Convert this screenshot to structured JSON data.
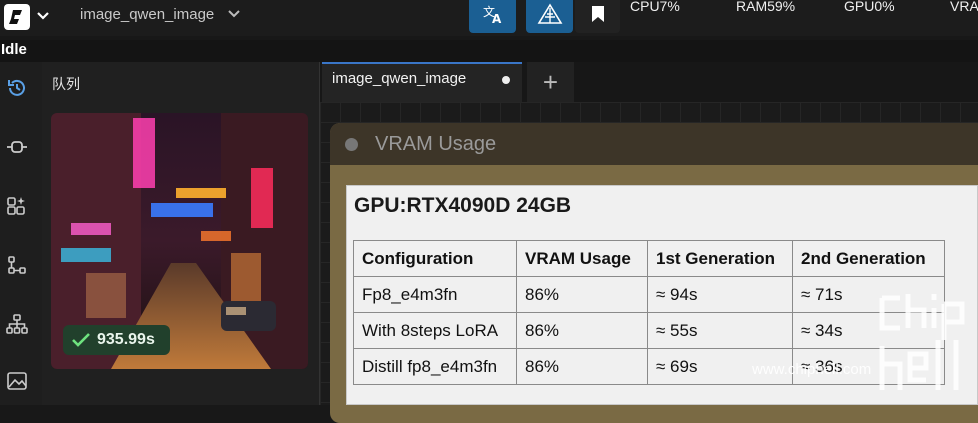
{
  "header": {
    "workflow_name": "image_qwen_image",
    "icons": {
      "logo": "comfy-logo-icon",
      "menu_chevron": "chevron-down-icon",
      "translate": "translate-icon",
      "manager": "manager-icon",
      "bookmark": "bookmark-icon"
    },
    "stats": {
      "cpu": "CPU7%",
      "ram": "RAM59%",
      "gpu": "GPU0%",
      "vram": "VRA"
    }
  },
  "status": "Idle",
  "sidebar": {
    "items": [
      "history-icon",
      "node-library-icon",
      "model-library-icon",
      "workflows-icon",
      "templates-icon",
      "image-gallery-icon"
    ]
  },
  "queue": {
    "title": "队列",
    "items": [
      {
        "time": "935.99s",
        "status": "completed"
      }
    ]
  },
  "tabs": [
    {
      "label": "image_qwen_image",
      "active": true,
      "unsaved": true
    }
  ],
  "tab_add_label": "+",
  "node": {
    "title": "VRAM Usage",
    "gpu_title": "GPU:RTX4090D 24GB",
    "table": {
      "headers": [
        "Configuration",
        "VRAM Usage",
        "1st Generation",
        "2nd Generation"
      ],
      "rows": [
        [
          "Fp8_e4m3fn",
          "86%",
          "≈ 94s",
          "≈ 71s"
        ],
        [
          "With 8steps LoRA",
          "86%",
          "≈ 55s",
          "≈ 34s"
        ],
        [
          "Distill fp8_e4m3fn",
          "86%",
          "≈ 69s",
          "≈ 36s"
        ]
      ]
    }
  },
  "watermark": "www.chiphell.com",
  "colors": {
    "accent": "#1b5f93",
    "tab_active_border": "#3a76c8",
    "success": "#21402c",
    "node_frame": "#7a6a44"
  }
}
